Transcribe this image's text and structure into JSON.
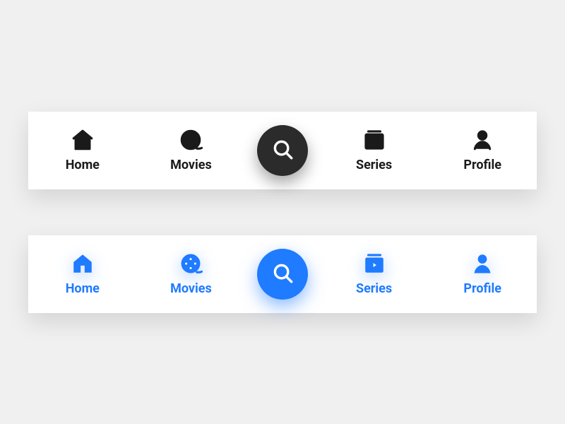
{
  "nav": {
    "home": {
      "label": "Home"
    },
    "movies": {
      "label": "Movies"
    },
    "series": {
      "label": "Series"
    },
    "profile": {
      "label": "Profile"
    }
  },
  "colors": {
    "dark": "#2b2b2b",
    "blue": "#1f7bff",
    "bg": "#f0f0f1",
    "panel": "#ffffff"
  }
}
